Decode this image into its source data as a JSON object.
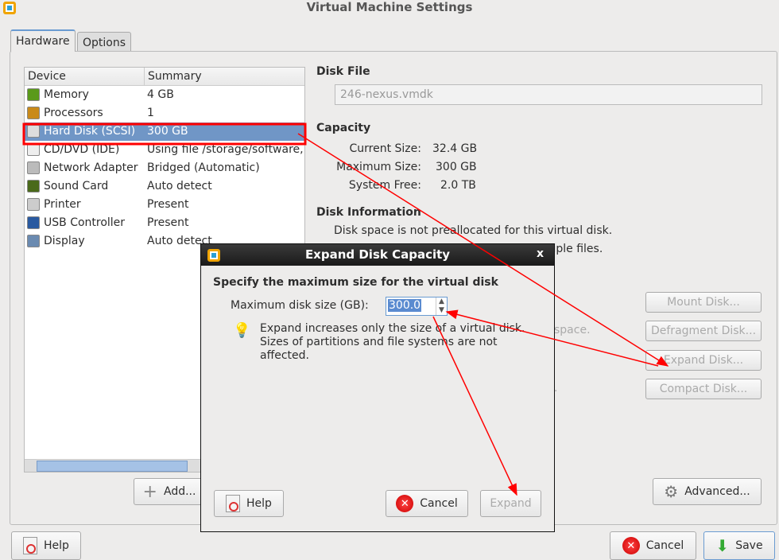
{
  "window": {
    "title": "Virtual Machine Settings"
  },
  "tabs": [
    {
      "label": "Hardware",
      "active": true
    },
    {
      "label": "Options",
      "active": false
    }
  ],
  "device_list": {
    "headers": [
      "Device",
      "Summary"
    ],
    "rows": [
      {
        "device": "Memory",
        "summary": "4 GB",
        "icon": "memory-icon",
        "color": "#5a9a1a"
      },
      {
        "device": "Processors",
        "summary": "1",
        "icon": "processor-icon",
        "color": "#c98a1a"
      },
      {
        "device": "Hard Disk (SCSI)",
        "summary": "300 GB",
        "icon": "hard-disk-icon",
        "color": "#ddd",
        "selected": true
      },
      {
        "device": "CD/DVD (IDE)",
        "summary": "Using file /storage/software,",
        "icon": "cd-dvd-icon",
        "color": "#eee"
      },
      {
        "device": "Network Adapter",
        "summary": "Bridged (Automatic)",
        "icon": "network-adapter-icon",
        "color": "#bbb"
      },
      {
        "device": "Sound Card",
        "summary": "Auto detect",
        "icon": "sound-card-icon",
        "color": "#4a6a1a"
      },
      {
        "device": "Printer",
        "summary": "Present",
        "icon": "printer-icon",
        "color": "#ccc"
      },
      {
        "device": "USB Controller",
        "summary": "Present",
        "icon": "usb-icon",
        "color": "#2a5aa0"
      },
      {
        "device": "Display",
        "summary": "Auto detect",
        "icon": "display-icon",
        "color": "#6a8ab0"
      }
    ],
    "add_label": "Add..."
  },
  "disk_file": {
    "heading": "Disk File",
    "value": "246-nexus.vmdk"
  },
  "capacity": {
    "heading": "Capacity",
    "current_label": "Current Size:",
    "current": "32.4 GB",
    "max_label": "Maximum Size:",
    "max": "300 GB",
    "free_label": "System Free:",
    "free": "2.0 TB"
  },
  "disk_info": {
    "heading": "Disk Information",
    "line1": "Disk space is not preallocated for this virtual disk.",
    "line2_visible": "tiple files.",
    "line3_visible": "space.",
    "line4_visible": "."
  },
  "disk_buttons": {
    "mount": "Mount Disk...",
    "defrag": "Defragment Disk...",
    "expand": "Expand Disk...",
    "compact": "Compact Disk...",
    "advanced": "Advanced..."
  },
  "footer": {
    "help": "Help",
    "cancel": "Cancel",
    "save": "Save"
  },
  "dialog": {
    "title": "Expand Disk Capacity",
    "close": "x",
    "heading": "Specify the maximum size for the virtual disk",
    "size_label": "Maximum disk size (GB):",
    "size_value": "300.0",
    "info1": "Expand increases only the size of a virtual disk.",
    "info2": "Sizes of partitions and file systems are not",
    "info3": "affected.",
    "help": "Help",
    "cancel": "Cancel",
    "expand": "Expand"
  },
  "annotation_color": "#ff0000"
}
